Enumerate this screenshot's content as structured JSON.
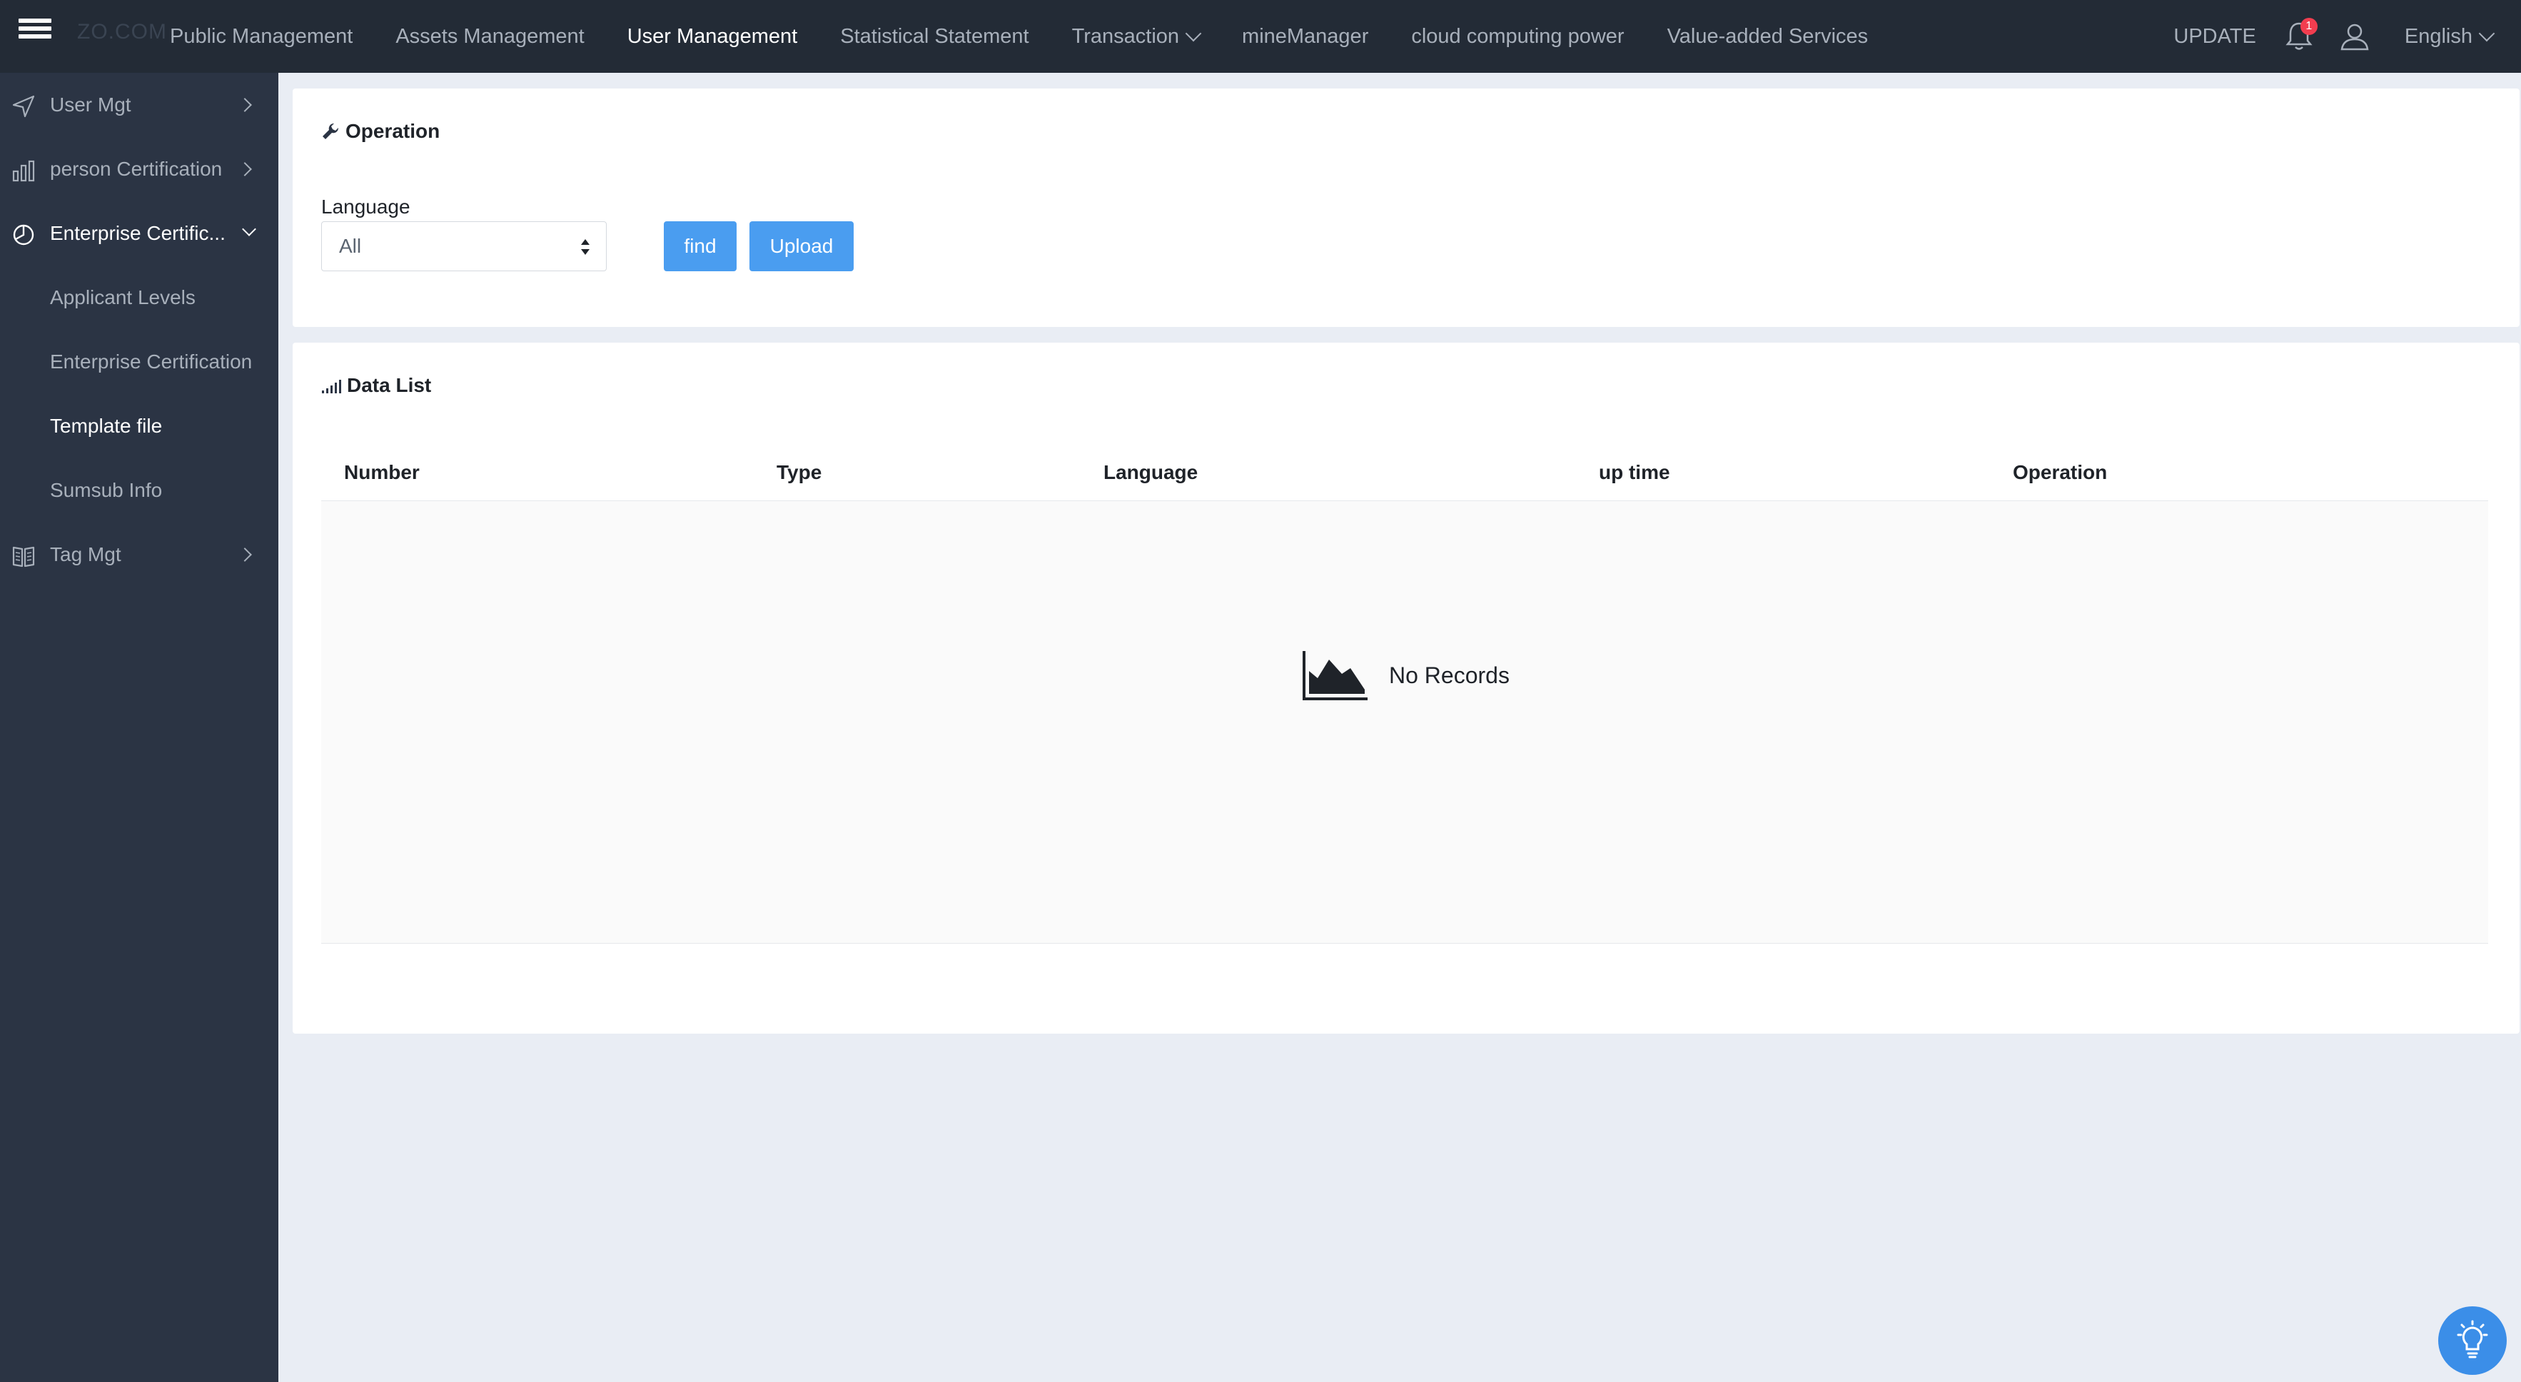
{
  "app": {
    "logo_text": "ZO.COM"
  },
  "nav": {
    "items": [
      {
        "label": "Public Management"
      },
      {
        "label": "Assets Management"
      },
      {
        "label": "User Management"
      },
      {
        "label": "Statistical Statement"
      },
      {
        "label": "Transaction"
      },
      {
        "label": "mineManager"
      },
      {
        "label": "cloud computing power"
      },
      {
        "label": "Value-added Services"
      }
    ],
    "active": "User Management",
    "update_label": "UPDATE",
    "notification_count": "1",
    "language": "English"
  },
  "sidebar": {
    "items": [
      {
        "label": "User Mgt",
        "icon": "send-icon"
      },
      {
        "label": "person Certification",
        "icon": "bar-chart-icon"
      },
      {
        "label": "Enterprise Certific...",
        "icon": "pie-chart-icon"
      },
      {
        "label": "Tag Mgt",
        "icon": "book-icon"
      }
    ],
    "subitems": [
      {
        "label": "Applicant Levels"
      },
      {
        "label": "Enterprise Certification"
      },
      {
        "label": "Template file"
      },
      {
        "label": "Sumsub Info"
      }
    ],
    "active_subitem": "Template file"
  },
  "operation": {
    "title": "Operation",
    "language_label": "Language",
    "language_value": "All",
    "find_label": "find",
    "upload_label": "Upload"
  },
  "data_list": {
    "title": "Data List",
    "columns": [
      "Number",
      "Type",
      "Language",
      "up time",
      "Operation"
    ],
    "rows": [],
    "empty_text": "No Records"
  },
  "colors": {
    "topbar": "#232b36",
    "sidebar": "#2b3444",
    "primary": "#4a9df0",
    "background": "#e9edf4",
    "badge": "#f23d4f"
  }
}
